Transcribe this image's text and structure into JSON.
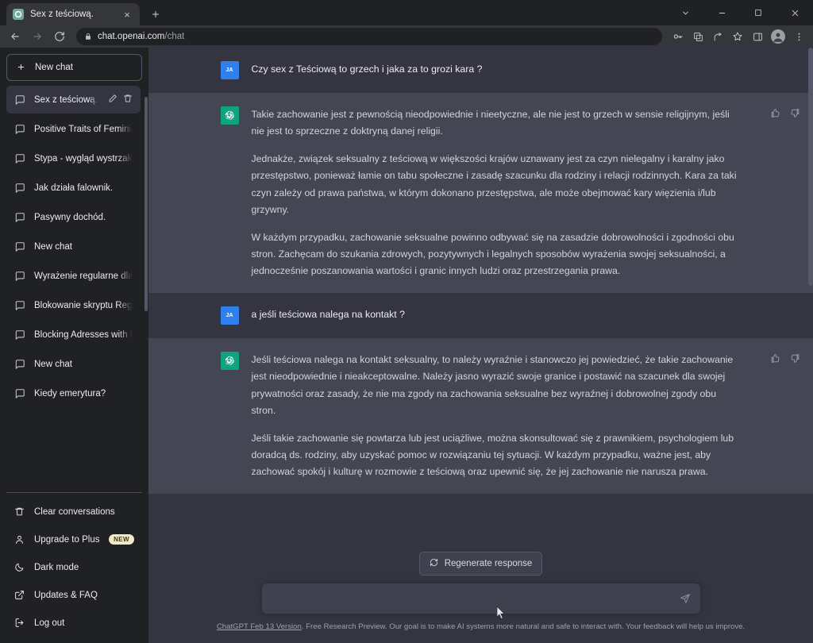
{
  "browser": {
    "tab": {
      "title": "Sex z teściową.",
      "favicon": "chatgpt-favicon",
      "close": "×"
    },
    "new_tab_label": "+",
    "window_controls": {
      "more": "chevron-down-icon",
      "minimize": "minimize-icon",
      "maximize": "maximize-icon",
      "close": "close-icon"
    },
    "nav": {
      "back": "back-arrow-icon",
      "forward": "forward-arrow-icon",
      "reload": "reload-icon"
    },
    "address": {
      "lock": "lock-icon",
      "host": "chat.openai.com",
      "path": "/chat",
      "full": "chat.openai.com/chat"
    },
    "toolbar_icons": [
      "key-icon",
      "translate-icon",
      "share-icon",
      "bookmark-star-icon",
      "side-panel-icon",
      "profile-avatar-icon",
      "chrome-menu-icon"
    ]
  },
  "sidebar": {
    "new_chat_label": "New chat",
    "chats": [
      {
        "label": "Sex z teściową.",
        "active": true
      },
      {
        "label": "Positive Traits of Feminists",
        "active": false
      },
      {
        "label": "Stypa - wygląd wystrzałowy!",
        "active": false
      },
      {
        "label": "Jak działa falownik.",
        "active": false
      },
      {
        "label": "Pasywny dochód.",
        "active": false
      },
      {
        "label": "New chat",
        "active": false
      },
      {
        "label": "Wyrażenie regularne dla bloka",
        "active": false
      },
      {
        "label": "Blokowanie skryptu RegEx",
        "active": false
      },
      {
        "label": "Blocking Adresses with RegEx",
        "active": false
      },
      {
        "label": "New chat",
        "active": false
      },
      {
        "label": "Kiedy emerytura?",
        "active": false
      }
    ],
    "bottom": [
      {
        "label": "Clear conversations",
        "icon": "trash-icon",
        "badge": ""
      },
      {
        "label": "Upgrade to Plus",
        "icon": "user-icon",
        "badge": "NEW"
      },
      {
        "label": "Dark mode",
        "icon": "moon-icon",
        "badge": ""
      },
      {
        "label": "Updates & FAQ",
        "icon": "external-link-icon",
        "badge": ""
      },
      {
        "label": "Log out",
        "icon": "logout-icon",
        "badge": ""
      }
    ]
  },
  "conversation": {
    "messages": [
      {
        "role": "user",
        "avatar_initials": "JA",
        "paragraphs": [
          "Czy sex z Teściową to grzech i jaka za to grozi kara ?"
        ]
      },
      {
        "role": "assistant",
        "avatar_initials": "",
        "paragraphs": [
          "Takie zachowanie jest z pewnością nieodpowiednie i nieetyczne, ale nie jest to grzech w sensie religijnym, jeśli nie jest to sprzeczne z doktryną danej religii.",
          "Jednakże, związek seksualny z teściową w większości krajów uznawany jest za czyn nielegalny i karalny jako przestępstwo, ponieważ łamie on tabu społeczne i zasadę szacunku dla rodziny i relacji rodzinnych. Kara za taki czyn zależy od prawa państwa, w którym dokonano przestępstwa, ale może obejmować kary więzienia i/lub grzywny.",
          "W każdym przypadku, zachowanie seksualne powinno odbywać się na zasadzie dobrowolności i zgodności obu stron. Zachęcam do szukania zdrowych, pozytywnych i legalnych sposobów wyrażenia swojej seksualności, a jednocześnie poszanowania wartości i granic innych ludzi oraz przestrzegania prawa."
        ],
        "rate_up": "thumbs-up-icon",
        "rate_down": "thumbs-down-icon"
      },
      {
        "role": "user",
        "avatar_initials": "JA",
        "paragraphs": [
          "a jeśli teściowa nalega na kontakt ?"
        ]
      },
      {
        "role": "assistant",
        "avatar_initials": "",
        "paragraphs": [
          "Jeśli teściowa nalega na kontakt seksualny, to należy wyraźnie i stanowczo jej powiedzieć, że takie zachowanie jest nieodpowiednie i nieakceptowalne. Należy jasno wyrazić swoje granice i postawić na szacunek dla swojej prywatności oraz zasady, że nie ma zgody na zachowania seksualne bez wyraźnej i dobrowolnej zgody obu stron.",
          "Jeśli takie zachowanie się powtarza lub jest uciążliwe, można skonsultować się z prawnikiem, psychologiem lub doradcą ds. rodziny, aby uzyskać pomoc w rozwiązaniu tej sytuacji. W każdym przypadku, ważne jest, aby zachować spokój i kulturę w rozmowie z teściową oraz upewnić się, że jej zachowanie nie narusza prawa."
        ],
        "rate_up": "thumbs-up-icon",
        "rate_down": "thumbs-down-icon"
      }
    ]
  },
  "composer": {
    "regenerate_label": "Regenerate response",
    "regenerate_icon": "refresh-icon",
    "input_value": "",
    "input_placeholder": "",
    "send_icon": "send-icon"
  },
  "footer": {
    "link_text": "ChatGPT Feb 13 Version",
    "text": ". Free Research Preview. Our goal is to make AI systems more natural and safe to interact with. Your feedback will help us improve."
  },
  "colors": {
    "sidebar_bg": "#202123",
    "user_msg_bg": "#343541",
    "assistant_msg_bg": "#444654",
    "accent_green": "#10a37f",
    "user_avatar_blue": "#2f80ed",
    "badge_new": "#f2e9c8"
  }
}
